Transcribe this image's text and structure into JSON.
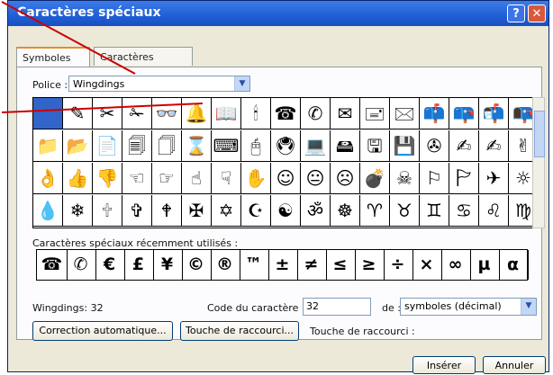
{
  "window": {
    "title": "Caractères spéciaux",
    "help_label": "?",
    "close_label": "✕"
  },
  "tabs": [
    {
      "label": "Symboles"
    },
    {
      "label": "Caractères spéciaux"
    }
  ],
  "font": {
    "label": "Police :",
    "value": "Wingdings"
  },
  "symbols_rows": [
    [
      "",
      "✎",
      "✂",
      "✁",
      "👓",
      "🔔",
      "📖",
      "🕯",
      "☎",
      "✆",
      "✉",
      "🖃",
      "🖂",
      "📫",
      "📪",
      "📬",
      "📭"
    ],
    [
      "📁",
      "📂",
      "📄",
      "🗐",
      "🗍",
      "⌛",
      "⌨",
      "🖰",
      "🖲",
      "💻",
      "🖴",
      "🖫",
      "💾",
      "✇",
      "✍",
      "✍",
      "✌"
    ],
    [
      "👌",
      "👍",
      "👎",
      "☜",
      "☞",
      "☝",
      "☟",
      "✋",
      "☺",
      "😐",
      "☹",
      "💣",
      "☠",
      "⚐",
      "🏱",
      "✈",
      "☼"
    ],
    [
      "💧",
      "❄",
      "🕆",
      "✞",
      "🕈",
      "✠",
      "✡",
      "☪",
      "☯",
      "ॐ",
      "☸",
      "♈",
      "♉",
      "♊",
      "♋",
      "♌",
      "♍"
    ]
  ],
  "recent": {
    "label": "Caractères spéciaux récemment utilisés :",
    "items": [
      "☎",
      "✆",
      "€",
      "£",
      "¥",
      "©",
      "®",
      "™",
      "±",
      "≠",
      "≤",
      "≥",
      "÷",
      "×",
      "∞",
      "µ",
      "α"
    ]
  },
  "char_info": {
    "name": "Wingdings: 32",
    "code_label": "Code du caractère :",
    "code_value": "32",
    "from_label": "de :",
    "from_value": "symboles (décimal)"
  },
  "buttons": {
    "autocorrect": "Correction automatique...",
    "shortcut_key": "Touche de raccourci...",
    "shortcut_label": "Touche de raccourci :",
    "insert": "Insérer",
    "cancel": "Annuler"
  },
  "colors": {
    "selected": "#3165c9",
    "annotation": "#cc0000",
    "titlebar": "#1f5fd6"
  }
}
